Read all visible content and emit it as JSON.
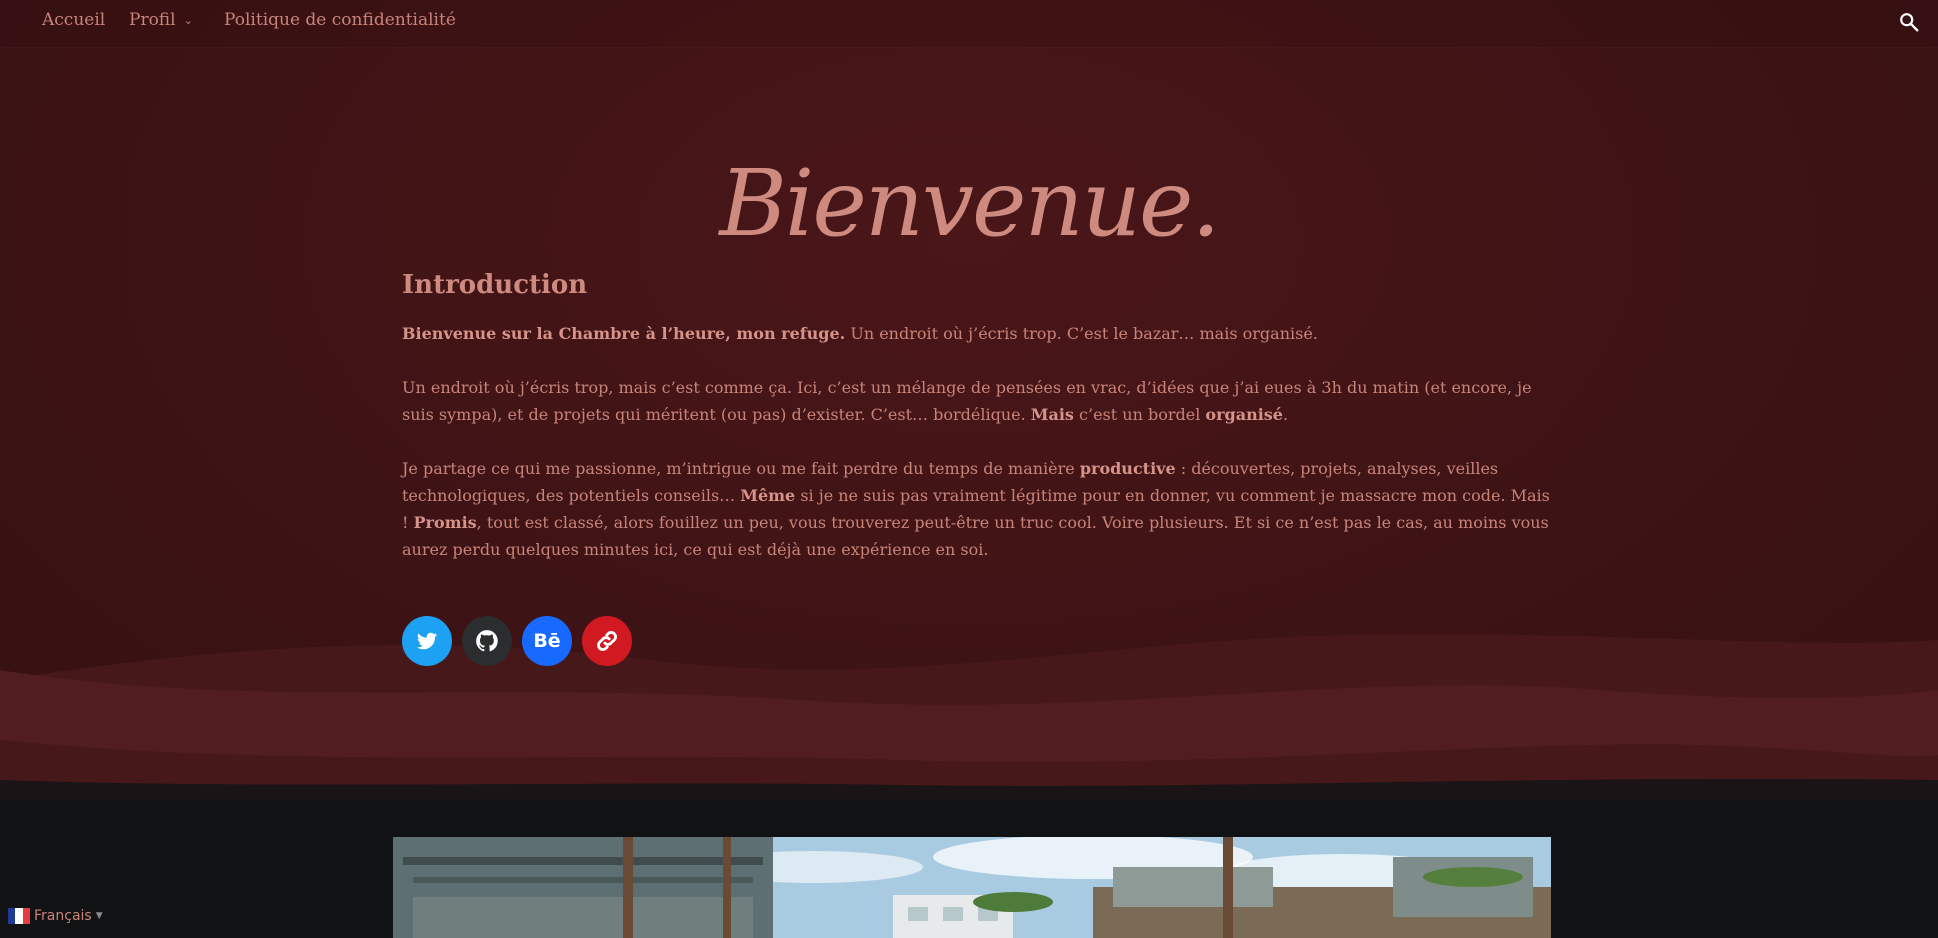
{
  "nav": {
    "items": [
      {
        "label": "Accueil"
      },
      {
        "label": "Profil",
        "has_dropdown": true
      },
      {
        "label": "Politique de confidentialité"
      }
    ],
    "search_icon": "search-icon"
  },
  "hero": {
    "title": "Bienvenue."
  },
  "content": {
    "heading": "Introduction",
    "p1": {
      "b1": "Bienvenue sur la Chambre à l’heure, mon refuge.",
      "t1": " Un endroit où j’écris trop. C’est le bazar… mais organisé."
    },
    "p2": {
      "t1": "Un endroit où j’écris trop, mais c’est comme ça. Ici, c’est un mélange de pensées en vrac, d’idées que j’ai eues à 3h du matin (et encore, je suis sympa), et de projets qui méritent (ou pas) d’exister. C’est… bordélique. ",
      "b1": "Mais",
      "t2": " c’est un bordel ",
      "b2": "organisé",
      "t3": "."
    },
    "p3": {
      "t1": "Je partage ce qui me passionne, m’intrigue ou me fait perdre du temps de manière ",
      "b1": "productive",
      "t2": " : découvertes, projets, analyses, veilles technologiques, des potentiels conseils… ",
      "b2": "Même",
      "t3": " si je ne suis pas vraiment légitime pour en donner, vu comment je massacre mon code. Mais ! ",
      "b3": "Promis",
      "t4": ", tout est classé, alors fouillez un peu, vous trouverez peut-être un truc cool. Voire plusieurs. Et si ce n’est pas le cas, au moins vous aurez perdu quelques minutes ici, ce qui est déjà une expérience en soi."
    }
  },
  "socials": [
    {
      "icon": "twitter-icon",
      "color": "#1da1f2"
    },
    {
      "icon": "github-icon",
      "color": "#2b2d2f"
    },
    {
      "icon": "behance-icon",
      "color": "#1769ff",
      "glyph": "Bē"
    },
    {
      "icon": "link-icon",
      "color": "#d01920"
    }
  ],
  "language": {
    "label": "Français",
    "flag": "france-flag-icon"
  },
  "colors": {
    "background": "#3e1315",
    "accent_text": "#c9847a",
    "footer_dark": "#101214"
  }
}
